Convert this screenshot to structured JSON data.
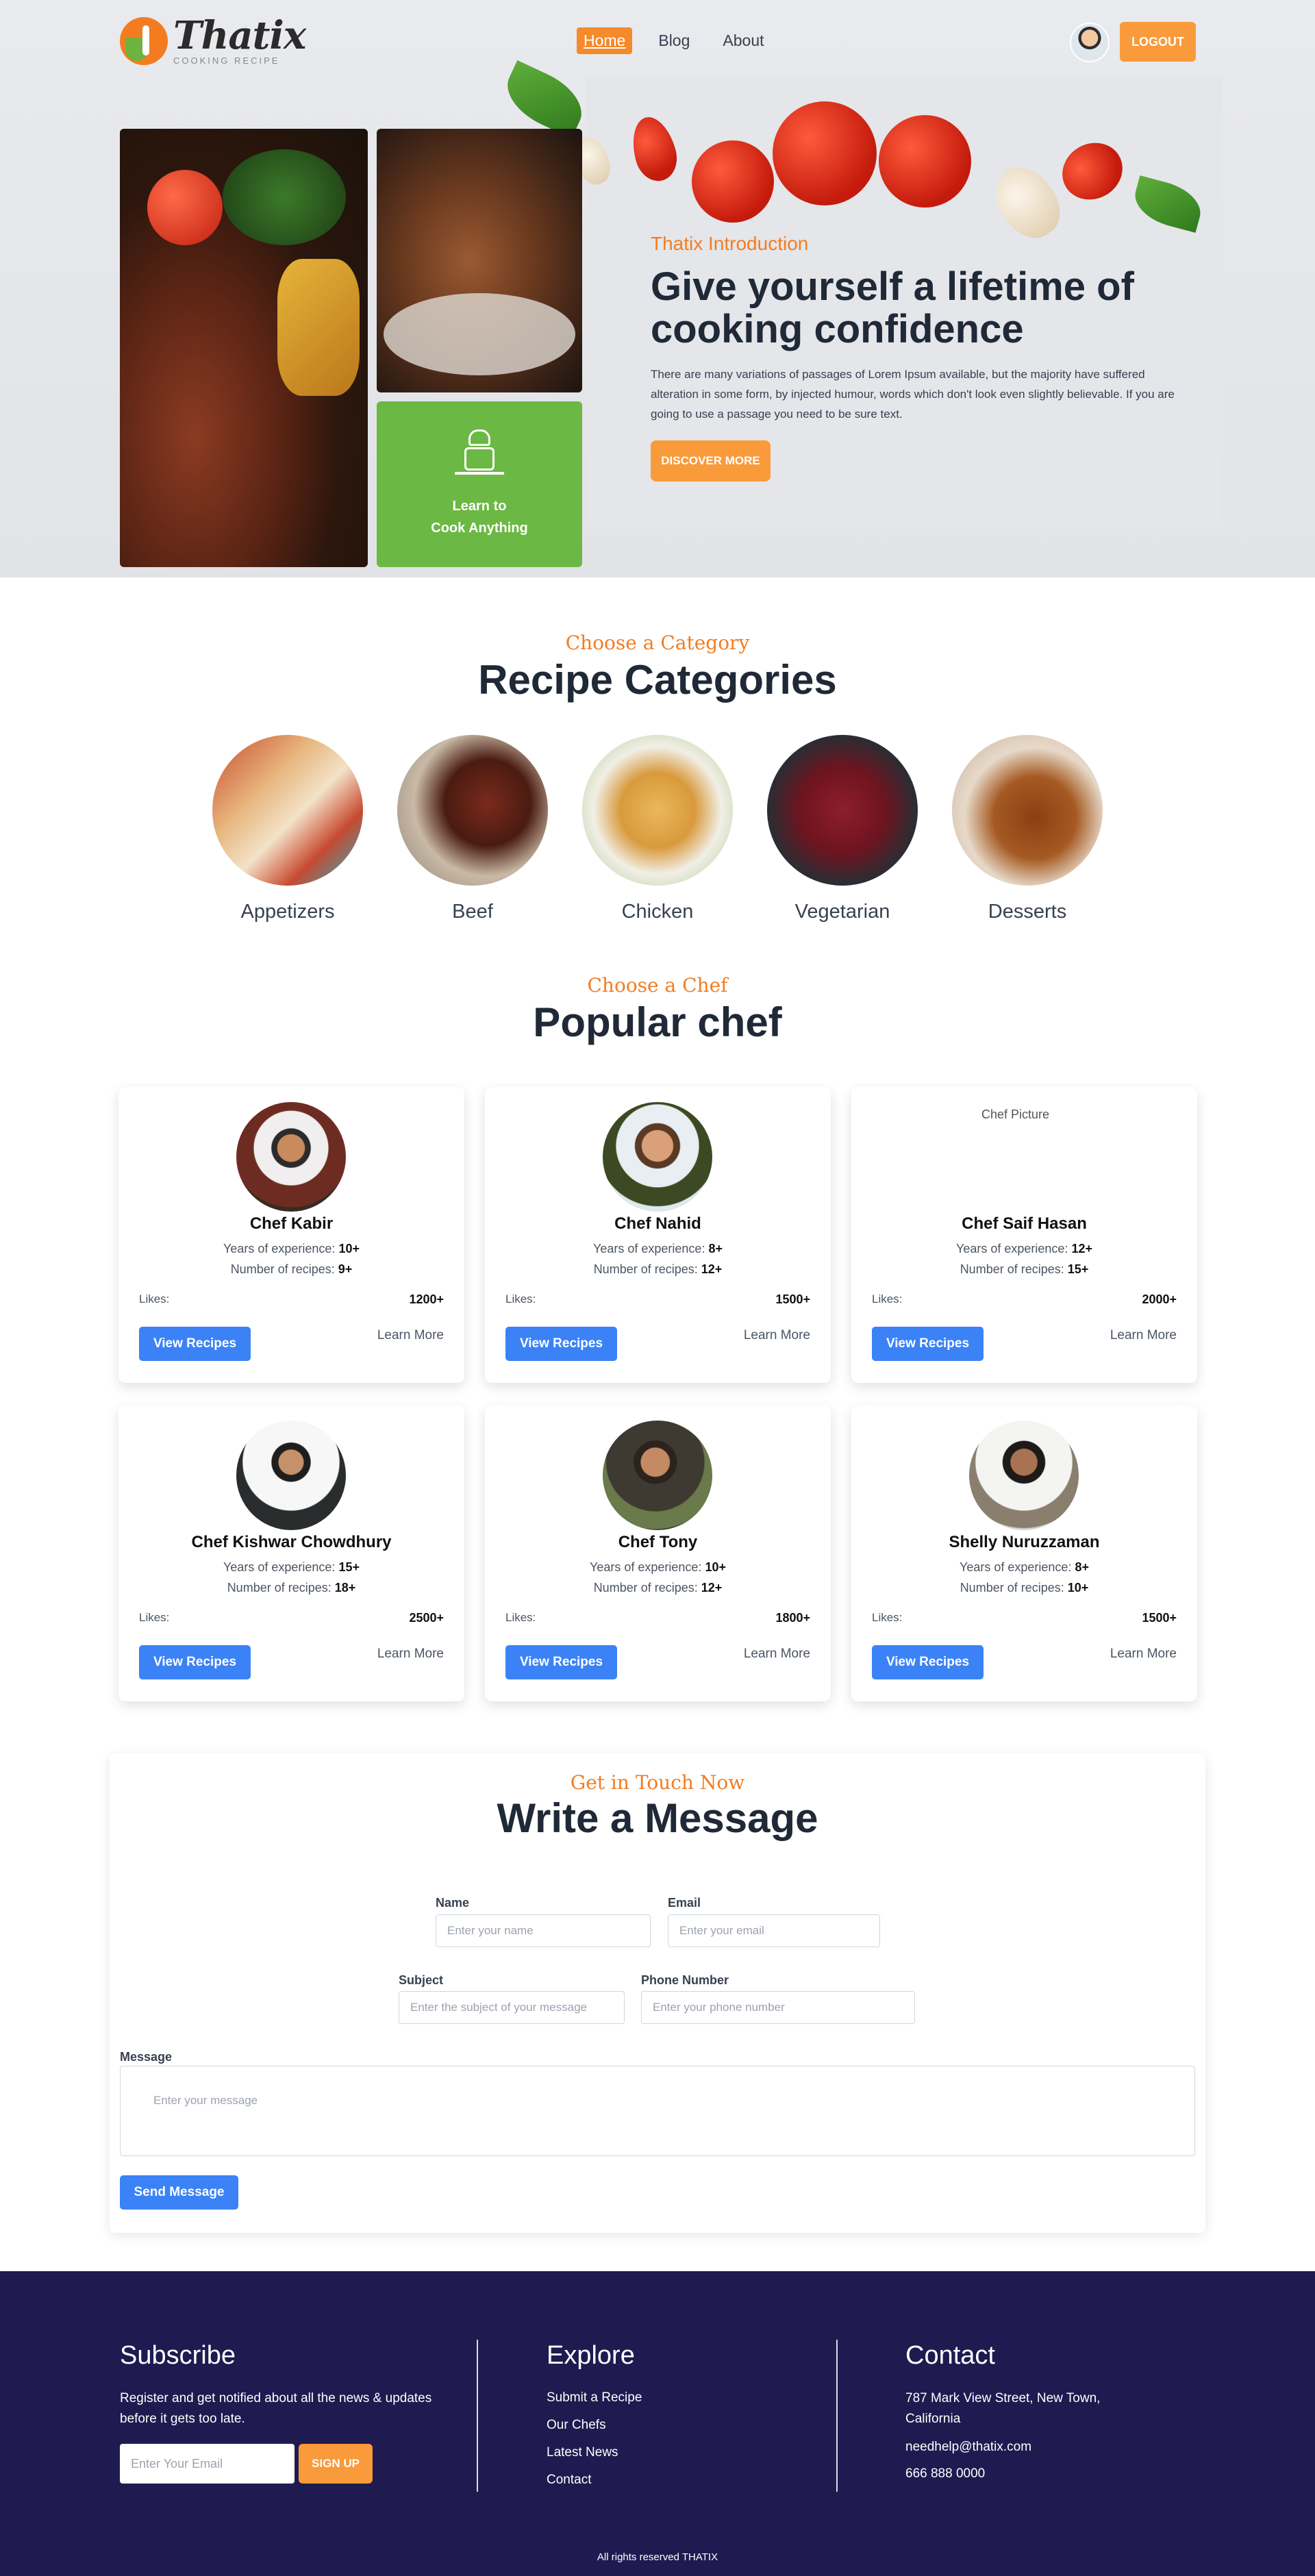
{
  "header": {
    "logo_title": "Thatix",
    "logo_subtitle": "COOKING RECIPE",
    "nav": [
      {
        "label": "Home",
        "active": true
      },
      {
        "label": "Blog",
        "active": false
      },
      {
        "label": "About",
        "active": false
      }
    ],
    "logout_label": "LOGOUT"
  },
  "hero": {
    "eyebrow": "Thatix Introduction",
    "title": "Give yourself a lifetime of cooking confidence",
    "description": "There are many variations of passages of Lorem Ipsum available, but the majority have suffered alteration in some form, by injected humour, words which don't look even slightly believable. If you are going to use a passage you need to be sure text.",
    "cta_label": "DISCOVER MORE",
    "learn_box_line1": "Learn to",
    "learn_box_line2": "Cook Anything"
  },
  "categories": {
    "eyebrow": "Choose a Category",
    "title": "Recipe Categories",
    "items": [
      {
        "label": "Appetizers"
      },
      {
        "label": "Beef"
      },
      {
        "label": "Chicken"
      },
      {
        "label": "Vegetarian"
      },
      {
        "label": "Desserts"
      }
    ]
  },
  "chefs": {
    "eyebrow": "Choose a Chef",
    "title": "Popular chef",
    "experience_label": "Years of experience:",
    "recipes_label": "Number of recipes:",
    "likes_label": "Likes:",
    "view_label": "View Recipes",
    "learn_label": "Learn More",
    "broken_image_alt": "Chef Picture",
    "items": [
      {
        "name": "Chef Kabir",
        "experience": "10+",
        "recipes": "9+",
        "likes": "1200+"
      },
      {
        "name": "Chef Nahid",
        "experience": "8+",
        "recipes": "12+",
        "likes": "1500+"
      },
      {
        "name": "Chef Saif Hasan",
        "experience": "12+",
        "recipes": "15+",
        "likes": "2000+"
      },
      {
        "name": "Chef Kishwar Chowdhury",
        "experience": "15+",
        "recipes": "18+",
        "likes": "2500+"
      },
      {
        "name": "Chef Tony",
        "experience": "10+",
        "recipes": "12+",
        "likes": "1800+"
      },
      {
        "name": "Shelly Nuruzzaman",
        "experience": "8+",
        "recipes": "10+",
        "likes": "1500+"
      }
    ]
  },
  "contact": {
    "eyebrow": "Get in Touch Now",
    "title": "Write a Message",
    "name_label": "Name",
    "name_placeholder": "Enter your name",
    "email_label": "Email",
    "email_placeholder": "Enter your email",
    "subject_label": "Subject",
    "subject_placeholder": "Enter the subject of your message",
    "phone_label": "Phone Number",
    "phone_placeholder": "Enter your phone number",
    "message_label": "Message",
    "message_placeholder": "Enter your message",
    "send_label": "Send Message"
  },
  "footer": {
    "subscribe_title": "Subscribe",
    "subscribe_text": "Register and get notified about all the news & updates before it gets too late.",
    "email_placeholder": "Enter Your Email",
    "signup_label": "SIGN UP",
    "explore_title": "Explore",
    "explore_links": [
      "Submit a Recipe",
      "Our Chefs",
      "Latest News",
      "Contact"
    ],
    "contact_title": "Contact",
    "address": "787 Mark View Street, New Town, California",
    "email": "needhelp@thatix.com",
    "phone": "666 888 0000",
    "copyright": "All rights reserved THATIX"
  }
}
